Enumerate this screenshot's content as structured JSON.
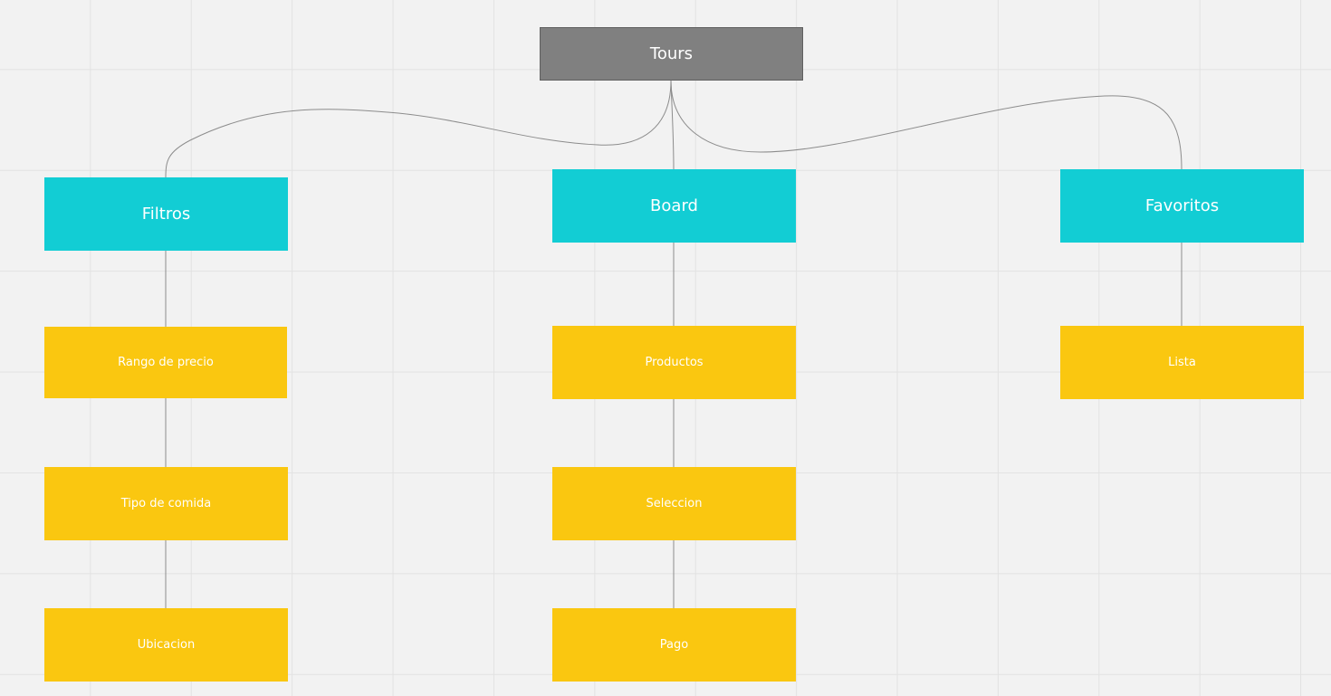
{
  "colors": {
    "root": "#808080",
    "section": "#12cdd4",
    "leaf": "#fac710",
    "connector": "#8c8c8c",
    "background": "#f2f2f2"
  },
  "root": {
    "label": "Tours"
  },
  "sections": [
    {
      "label": "Filtros",
      "children": [
        "Rango de precio",
        "Tipo de comida",
        "Ubicacion"
      ]
    },
    {
      "label": "Board",
      "children": [
        "Productos",
        "Seleccion",
        "Pago"
      ]
    },
    {
      "label": "Favoritos",
      "children": [
        "Lista"
      ]
    }
  ]
}
